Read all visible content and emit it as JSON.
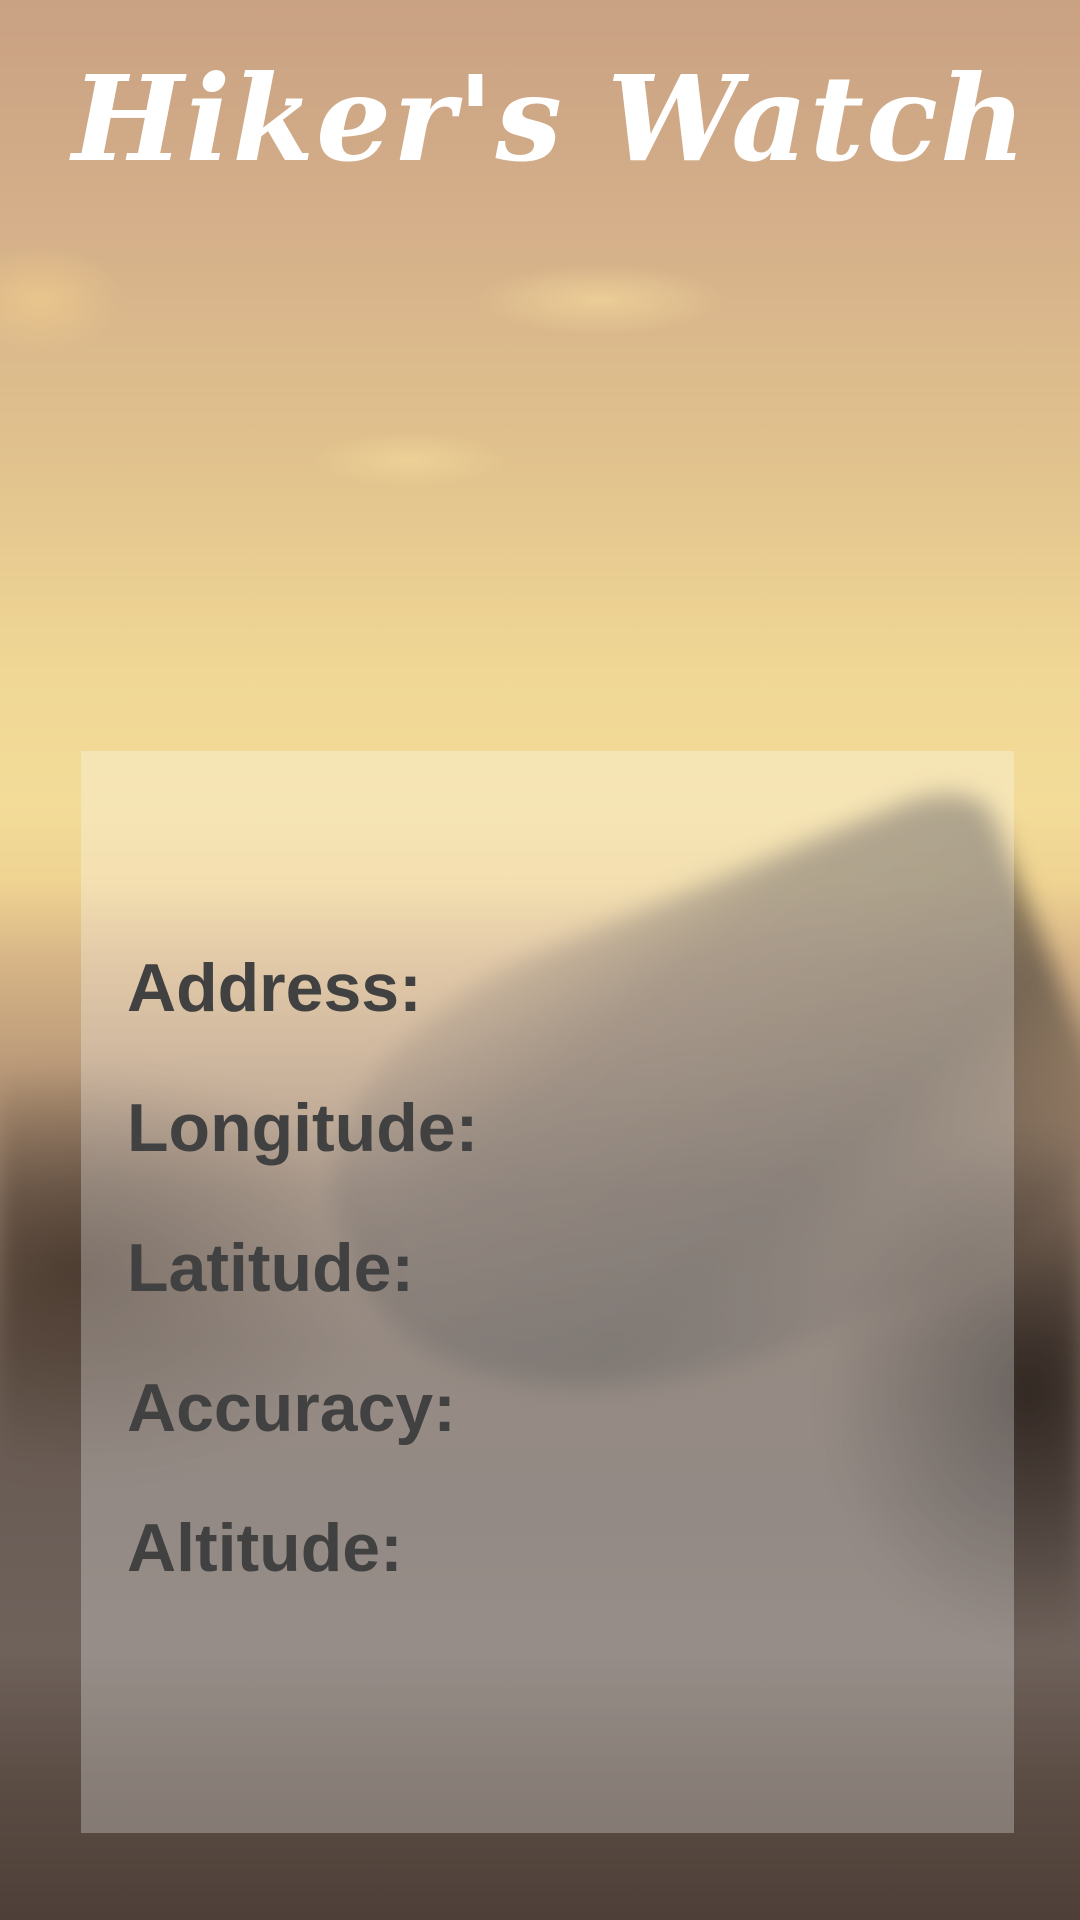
{
  "app": {
    "title": "Hiker's Watch"
  },
  "info_panel": {
    "fields": [
      {
        "label": "Address:"
      },
      {
        "label": "Longitude:"
      },
      {
        "label": "Latitude:"
      },
      {
        "label": "Accuracy:"
      },
      {
        "label": "Altitude:"
      }
    ]
  }
}
